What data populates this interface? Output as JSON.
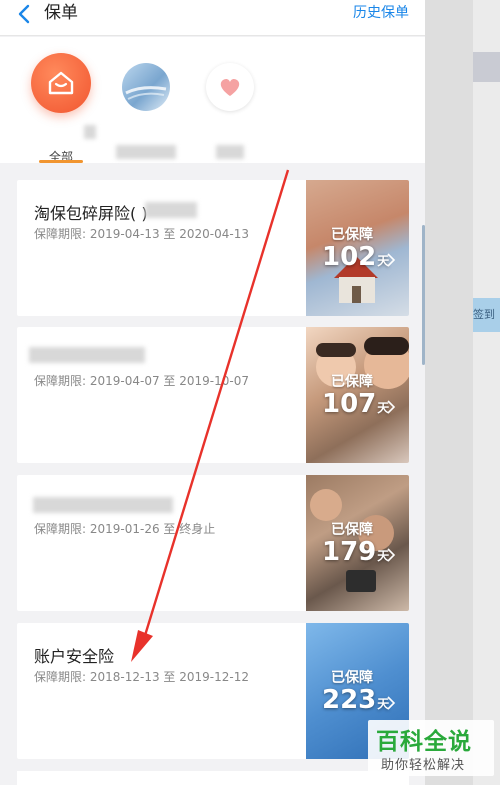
{
  "header": {
    "title": "保单",
    "history_label": "历史保单"
  },
  "categories": [
    {
      "label": "全部"
    },
    {
      "label": ""
    },
    {
      "label": ""
    }
  ],
  "policies": [
    {
      "name": "淘保包碎屏险",
      "name_suffix": "(          )",
      "period": "保障期限: 2019-04-13 至 2020-04-13",
      "status": "已保障",
      "days": "102",
      "unit": "天"
    },
    {
      "name": "",
      "name_suffix": "",
      "period": "保障期限: 2019-04-07 至 2019-10-07",
      "status": "已保障",
      "days": "107",
      "unit": "天"
    },
    {
      "name": "",
      "name_suffix": "",
      "period": "保障期限: 2019-01-26 至 终身止",
      "status": "已保障",
      "days": "179",
      "unit": "天"
    },
    {
      "name": "账户安全险",
      "name_suffix": "",
      "period": "保障期限: 2018-12-13 至 2019-12-12",
      "status": "已保障",
      "days": "223",
      "unit": "天"
    }
  ],
  "side": {
    "tag_text": "签到"
  },
  "watermark": {
    "title": "百科全说",
    "subtitle": "助你轻松解决"
  },
  "colors": {
    "accent_blue": "#1a86e8",
    "orange": "#f1552f",
    "arrow_red": "#e8322b",
    "watermark_green": "#2aa93b"
  }
}
